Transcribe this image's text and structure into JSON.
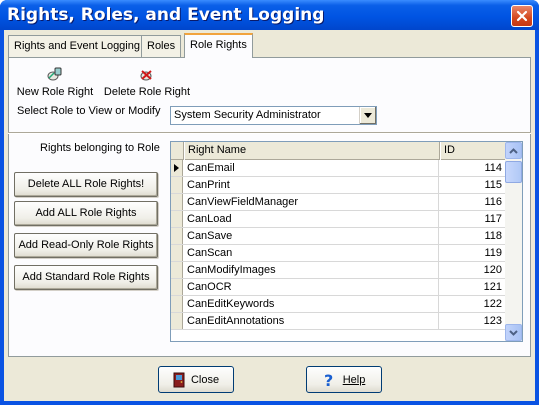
{
  "window": {
    "title": "Rights, Roles, and Event Logging"
  },
  "tabs": [
    {
      "label": "Rights and Event Logging"
    },
    {
      "label": "Roles"
    },
    {
      "label": "Role Rights"
    }
  ],
  "toolbar": {
    "new_label": "New Role Right",
    "delete_label": "Delete Role Right"
  },
  "role_select": {
    "label": "Select Role to View or Modify",
    "value": "System Security Administrator"
  },
  "rights_section": {
    "label": "Rights belonging to Role"
  },
  "actions": [
    {
      "label": "Delete ALL Role Rights!"
    },
    {
      "label": "Add ALL Role Rights"
    },
    {
      "label": "Add Read-Only Role Rights"
    },
    {
      "label": "Add Standard Role Rights"
    }
  ],
  "grid": {
    "columns": [
      "Right Name",
      "ID"
    ],
    "rows": [
      {
        "name": "CanEmail",
        "id": "114"
      },
      {
        "name": "CanPrint",
        "id": "115"
      },
      {
        "name": "CanViewFieldManager",
        "id": "116"
      },
      {
        "name": "CanLoad",
        "id": "117"
      },
      {
        "name": "CanSave",
        "id": "118"
      },
      {
        "name": "CanScan",
        "id": "119"
      },
      {
        "name": "CanModifyImages",
        "id": "120"
      },
      {
        "name": "CanOCR",
        "id": "121"
      },
      {
        "name": "CanEditKeywords",
        "id": "122"
      },
      {
        "name": "CanEditAnnotations",
        "id": "123"
      }
    ]
  },
  "footer": {
    "close_label": "Close",
    "help_label": "Help"
  },
  "colors": {
    "titlebar": "#0054e3",
    "dialog_bg": "#ece9d8",
    "close_button": "#d4481e"
  }
}
